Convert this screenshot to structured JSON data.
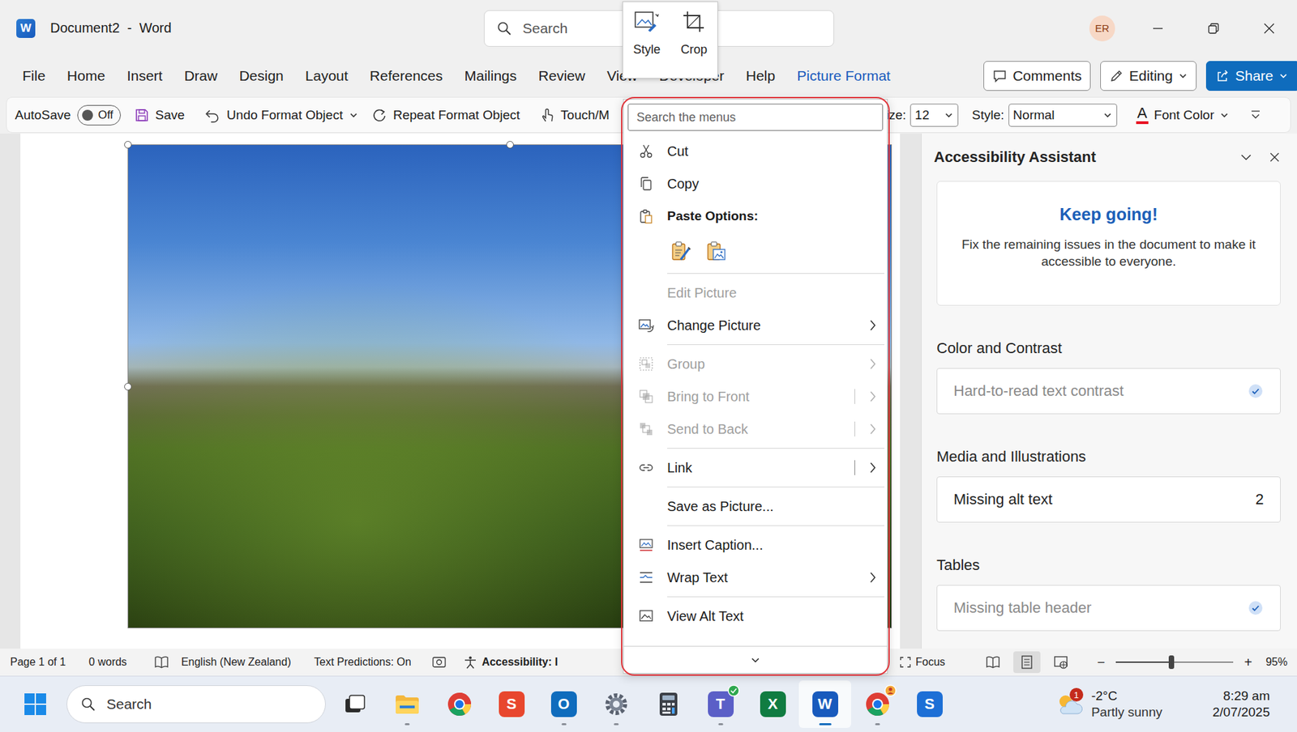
{
  "window": {
    "title": "Document2  -  Word",
    "app_glyph": "W",
    "search_placeholder": "Search",
    "user_initials": "ER"
  },
  "mini_toolbar": [
    {
      "label": "Style"
    },
    {
      "label": "Crop"
    }
  ],
  "tabs": [
    {
      "label": "File",
      "selected": false
    },
    {
      "label": "Home",
      "selected": false
    },
    {
      "label": "Insert",
      "selected": false
    },
    {
      "label": "Draw",
      "selected": false
    },
    {
      "label": "Design",
      "selected": false
    },
    {
      "label": "Layout",
      "selected": false
    },
    {
      "label": "References",
      "selected": false
    },
    {
      "label": "Mailings",
      "selected": false
    },
    {
      "label": "Review",
      "selected": false
    },
    {
      "label": "View",
      "selected": false
    },
    {
      "label": "Developer",
      "selected": false
    },
    {
      "label": "Help",
      "selected": false
    },
    {
      "label": "Picture Format",
      "selected": true
    }
  ],
  "ribbon_buttons": [
    {
      "label": "Comments",
      "kind": "outline"
    },
    {
      "label": "Editing",
      "kind": "dropdown"
    },
    {
      "label": "Share",
      "kind": "primary"
    }
  ],
  "quick_access": {
    "autosave": {
      "label": "AutoSave",
      "state": "Off",
      "on": false
    },
    "commands": [
      {
        "label": "Save",
        "dropdown": false
      },
      {
        "label": "Undo Format Object",
        "dropdown": true
      },
      {
        "label": "Repeat Format Object",
        "dropdown": false
      },
      {
        "label": "Touch/M",
        "dropdown": false
      }
    ],
    "font_size": {
      "label": "ize:",
      "value": "12"
    },
    "style": {
      "label": "Style:",
      "value": "Normal"
    },
    "font_color": {
      "glyph": "A",
      "label": "Font Color"
    }
  },
  "document": {
    "picture_selected": true
  },
  "context_menu": {
    "search_placeholder": "Search the menus",
    "items": [
      {
        "kind": "command",
        "label": "Cut",
        "disabled": false,
        "submenu": false,
        "split": false,
        "separator": false
      },
      {
        "kind": "command",
        "label": "Copy",
        "disabled": false,
        "submenu": false,
        "split": false,
        "separator": false
      },
      {
        "kind": "header",
        "label": "Paste Options:",
        "disabled": false,
        "submenu": false,
        "split": false,
        "separator": false
      },
      {
        "kind": "paste",
        "disabled": false,
        "submenu": false,
        "split": false,
        "separator": false
      },
      {
        "kind": "command",
        "label": "Edit Picture",
        "disabled": true,
        "submenu": false,
        "split": false,
        "separator": true
      },
      {
        "kind": "command",
        "label": "Change Picture",
        "disabled": false,
        "submenu": true,
        "split": false,
        "separator": false
      },
      {
        "kind": "command",
        "label": "Group",
        "disabled": true,
        "submenu": true,
        "split": false,
        "separator": true
      },
      {
        "kind": "command",
        "label": "Bring to Front",
        "disabled": true,
        "submenu": true,
        "split": true,
        "separator": false
      },
      {
        "kind": "command",
        "label": "Send to Back",
        "disabled": true,
        "submenu": true,
        "split": true,
        "separator": false
      },
      {
        "kind": "command",
        "label": "Link",
        "disabled": false,
        "submenu": true,
        "split": true,
        "separator": true
      },
      {
        "kind": "command",
        "label": "Save as Picture...",
        "disabled": false,
        "submenu": false,
        "split": false,
        "separator": true
      },
      {
        "kind": "command",
        "label": "Insert Caption...",
        "disabled": false,
        "submenu": false,
        "split": false,
        "separator": true
      },
      {
        "kind": "command",
        "label": "Wrap Text",
        "disabled": false,
        "submenu": true,
        "split": false,
        "separator": false
      },
      {
        "kind": "command",
        "label": "View Alt Text",
        "disabled": false,
        "submenu": false,
        "split": false,
        "separator": true
      }
    ]
  },
  "accessibility_pane": {
    "title": "Accessibility Assistant",
    "status_card": {
      "heading": "Keep going!",
      "message": "Fix the remaining issues in the document to make it accessible to everyone."
    },
    "sections": [
      {
        "heading": "Color and Contrast",
        "items": [
          {
            "label": "Hard-to-read text contrast",
            "resolved": true
          }
        ]
      },
      {
        "heading": "Media and Illustrations",
        "items": [
          {
            "label": "Missing alt text",
            "count": "2",
            "resolved": false
          }
        ]
      },
      {
        "heading": "Tables",
        "items": [
          {
            "label": "Missing table header",
            "resolved": true
          }
        ]
      }
    ]
  },
  "status_bar": {
    "page": "Page 1 of 1",
    "words": "0 words",
    "language": "English (New Zealand)",
    "text_predictions": "Text Predictions: On",
    "accessibility": "Accessibility: I",
    "focus": "Focus",
    "views": [
      {
        "selected": false
      },
      {
        "selected": true
      },
      {
        "selected": false
      }
    ],
    "zoom": {
      "minus": "−",
      "plus": "+",
      "level": 0.47,
      "reading": "95%"
    }
  },
  "taskbar": {
    "search_placeholder": "Search",
    "apps": [
      {
        "running": false,
        "active": false,
        "badge": false
      },
      {
        "running": true,
        "active": false,
        "badge": false
      },
      {
        "running": false,
        "active": false,
        "badge": false
      },
      {
        "glyph": "S",
        "running": false,
        "active": false,
        "badge": false
      },
      {
        "glyph": "O",
        "running": true,
        "active": false,
        "badge": false
      },
      {
        "running": true,
        "active": false,
        "badge": false
      },
      {
        "running": false,
        "active": false,
        "badge": false
      },
      {
        "glyph": "T",
        "running": true,
        "active": false,
        "badge": true
      },
      {
        "glyph": "X",
        "running": false,
        "active": false,
        "badge": false
      },
      {
        "glyph": "W",
        "running": true,
        "active": true,
        "badge": false
      },
      {
        "running": true,
        "active": false,
        "badge": true
      },
      {
        "glyph": "S",
        "running": false,
        "active": false,
        "badge": false
      }
    ],
    "weather": {
      "badge": "1",
      "temperature": "-2°C",
      "condition": "Partly sunny"
    },
    "clock": {
      "time": "8:29 am",
      "date": "2/07/2025"
    }
  }
}
